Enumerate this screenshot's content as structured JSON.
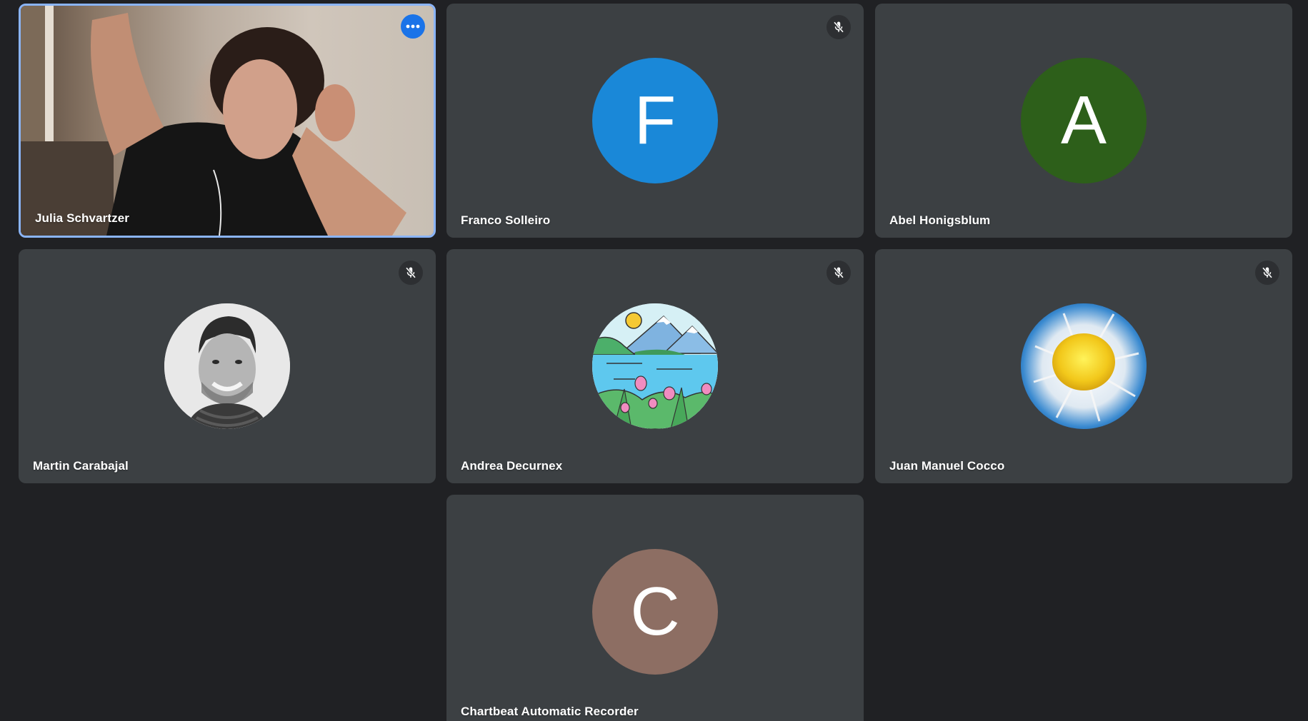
{
  "participants": [
    {
      "name": "Julia Schvartzer",
      "initial": "",
      "avatar_type": "video",
      "avatar_color": "",
      "muted": false,
      "active_speaker": true,
      "menu_icon": "more-horiz-icon"
    },
    {
      "name": "Franco Solleiro",
      "initial": "F",
      "avatar_type": "letter",
      "avatar_color": "#1a88d8",
      "muted": true,
      "active_speaker": false
    },
    {
      "name": "Abel Honigsblum",
      "initial": "A",
      "avatar_type": "letter",
      "avatar_color": "#2d5f1a",
      "muted": true,
      "active_speaker": false
    },
    {
      "name": "Martin Carabajal",
      "initial": "",
      "avatar_type": "photo-portrait",
      "avatar_color": "",
      "muted": true,
      "active_speaker": false
    },
    {
      "name": "Andrea Decurnex",
      "initial": "",
      "avatar_type": "illustration-lake",
      "avatar_color": "",
      "muted": true,
      "active_speaker": false
    },
    {
      "name": "Juan Manuel Cocco",
      "initial": "",
      "avatar_type": "photo-flower",
      "avatar_color": "",
      "muted": true,
      "active_speaker": false
    },
    {
      "name": "Chartbeat Automatic Recorder",
      "initial": "C",
      "avatar_type": "letter",
      "avatar_color": "#8d6e63",
      "muted": false,
      "active_speaker": false
    }
  ],
  "colors": {
    "background": "#202124",
    "tile": "#3c4043",
    "active_border": "#8ab4f8",
    "menu_button": "#1a73e8"
  }
}
